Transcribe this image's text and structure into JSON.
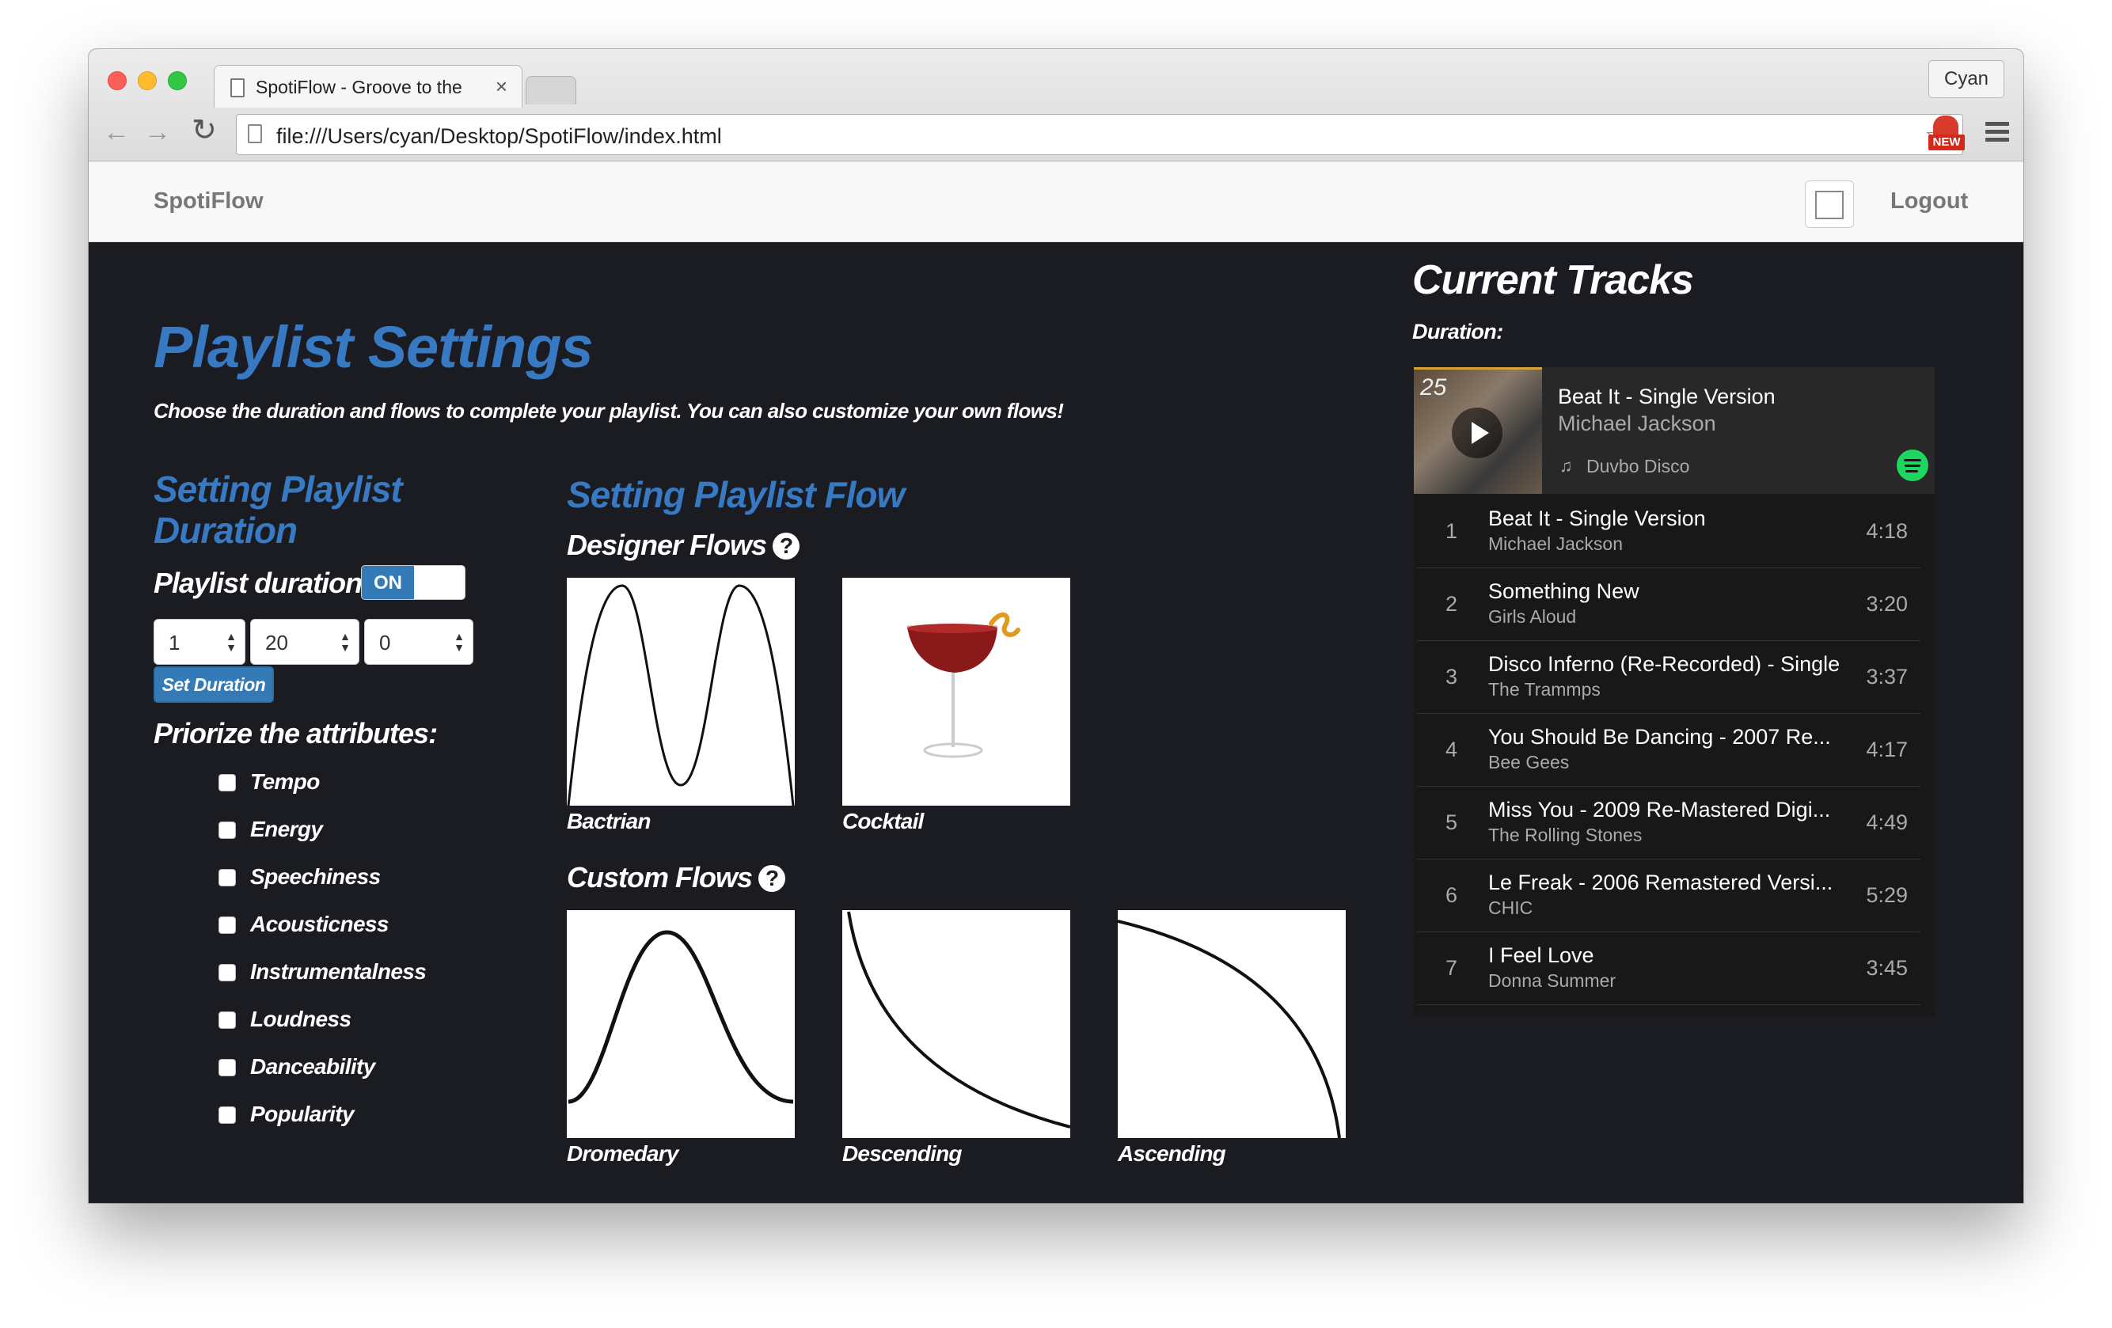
{
  "browser": {
    "tab_title": "SpotiFlow - Groove to the",
    "tab_close": "×",
    "profile": "Cyan",
    "back": "←",
    "forward": "→",
    "reload": "↻",
    "url": "file:///Users/cyan/Desktop/SpotiFlow/index.html",
    "star": "☆",
    "ext_badge": "NEW"
  },
  "navbar": {
    "brand": "SpotiFlow",
    "logout": "Logout"
  },
  "settings": {
    "title": "Playlist Settings",
    "subtitle": "Choose the duration and flows to complete your playlist. You can also customize your own flows!",
    "duration_heading": "Setting Playlist Duration",
    "duration_label": "Playlist duration:",
    "toggle_on": "ON",
    "hours": "1",
    "minutes": "20",
    "seconds": "0",
    "spinner_arrows": "▲▼",
    "set_duration": "Set Duration",
    "prioritize_heading": "Priorize the attributes:",
    "attributes": [
      "Tempo",
      "Energy",
      "Speechiness",
      "Acousticness",
      "Instrumentalness",
      "Loudness",
      "Danceability",
      "Popularity"
    ]
  },
  "flows": {
    "heading": "Setting Playlist Flow",
    "designer_heading": "Designer Flows",
    "custom_heading": "Custom Flows",
    "help_glyph": "?",
    "designer": [
      "Bactrian",
      "Cocktail"
    ],
    "custom": [
      "Dromedary",
      "Descending",
      "Ascending"
    ]
  },
  "tracks": {
    "heading": "Current Tracks",
    "duration_label": "Duration:",
    "now_playing": {
      "cover_number": "25",
      "title": "Beat It - Single Version",
      "artist": "Michael Jackson",
      "note_icon": "♫",
      "playlist": "Duvbo Disco"
    },
    "list": [
      {
        "num": "1",
        "title": "Beat It - Single Version",
        "artist": "Michael Jackson",
        "duration": "4:18"
      },
      {
        "num": "2",
        "title": "Something New",
        "artist": "Girls Aloud",
        "duration": "3:20"
      },
      {
        "num": "3",
        "title": "Disco Inferno (Re-Recorded) - Single",
        "artist": "The Trammps",
        "duration": "3:37"
      },
      {
        "num": "4",
        "title": "You Should Be Dancing - 2007 Re...",
        "artist": "Bee Gees",
        "duration": "4:17"
      },
      {
        "num": "5",
        "title": "Miss You - 2009 Re-Mastered Digi...",
        "artist": "The Rolling Stones",
        "duration": "4:49"
      },
      {
        "num": "6",
        "title": "Le Freak - 2006 Remastered Versi...",
        "artist": "CHIC",
        "duration": "5:29"
      },
      {
        "num": "7",
        "title": "I Feel Love",
        "artist": "Donna Summer",
        "duration": "3:45"
      }
    ]
  },
  "colors": {
    "accent": "#3779c3",
    "background": "#1a1c22",
    "spotify_green": "#1ed760"
  }
}
